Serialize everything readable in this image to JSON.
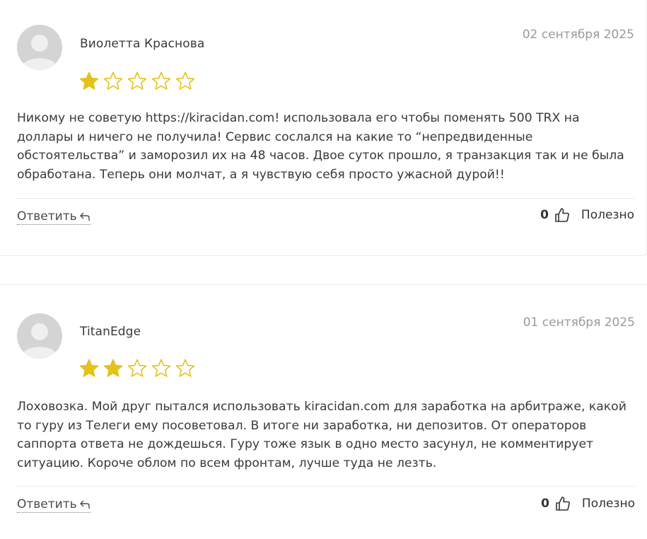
{
  "reviews": [
    {
      "author": "Виолетта Краснова",
      "date": "02 сентября 2025",
      "rating": 1,
      "max_rating": 5,
      "text": "Никому не советую https://kiracidan.com! использовала его чтобы поменять 500 TRX на доллары и ничего не получила! Сервис сослался на какие то “непредвиденные обстоятельства” и заморозил их на 48 часов. Двое суток прошло, я транзакция так и не была обработана. Теперь они молчат, а я чувствую себя просто ужасной дурой!!",
      "reply_label": "Ответить",
      "helpful_count": "0",
      "helpful_label": "Полезно"
    },
    {
      "author": "TitanEdge",
      "date": "01 сентября 2025",
      "rating": 2,
      "max_rating": 5,
      "text": "Лоховозка. Мой друг пытался использовать kiracidan.com для заработка на арбитраже, какой то гуру из Телеги ему посоветовал. В итоге ни заработка, ни депозитов. От операторов саппорта ответа не дождешься. Гуру тоже язык в одно место засунул, не комментирует ситуацию. Короче облом по всем фронтам, лучше туда не лезть.",
      "reply_label": "Ответить",
      "helpful_count": "0",
      "helpful_label": "Полезно"
    }
  ],
  "colors": {
    "star_filled": "#e5c21a",
    "star_outline": "#e5c21a",
    "avatar_bg": "#d7d7d7",
    "date_text": "#9a9a9a"
  },
  "icons": {
    "reply": "reply-arrow-icon",
    "helpful": "thumbs-up-icon",
    "avatar": "default-user-avatar-icon",
    "star": "star-icon"
  }
}
